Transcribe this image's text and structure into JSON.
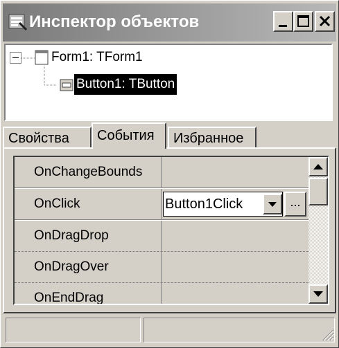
{
  "window": {
    "title": "Инспектор объектов",
    "caption_buttons": [
      "minimize-icon",
      "maximize-icon",
      "close-icon"
    ]
  },
  "tree": {
    "nodes": [
      {
        "label": "Form1: TForm1",
        "expanded": true,
        "selected": false,
        "icon": "form-icon"
      },
      {
        "label": "Button1: TButton",
        "selected": true,
        "icon": "button-component-icon"
      }
    ]
  },
  "tabs": [
    {
      "label": "Свойства",
      "active": false
    },
    {
      "label": "События",
      "active": true
    },
    {
      "label": "Избранное",
      "active": false
    }
  ],
  "events": [
    {
      "name": "OnChangeBounds",
      "value": ""
    },
    {
      "name": "OnClick",
      "value": "Button1Click",
      "editing": true
    },
    {
      "name": "OnDragDrop",
      "value": ""
    },
    {
      "name": "OnDragOver",
      "value": ""
    },
    {
      "name": "OnEndDrag",
      "value": ""
    }
  ],
  "editor": {
    "ellipsis_label": "..."
  },
  "status": {
    "panels": [
      "",
      ""
    ]
  },
  "colors": {
    "face": "#d4d0c8",
    "selection": "#000000",
    "titlebar_start": "#7a7a7a"
  }
}
